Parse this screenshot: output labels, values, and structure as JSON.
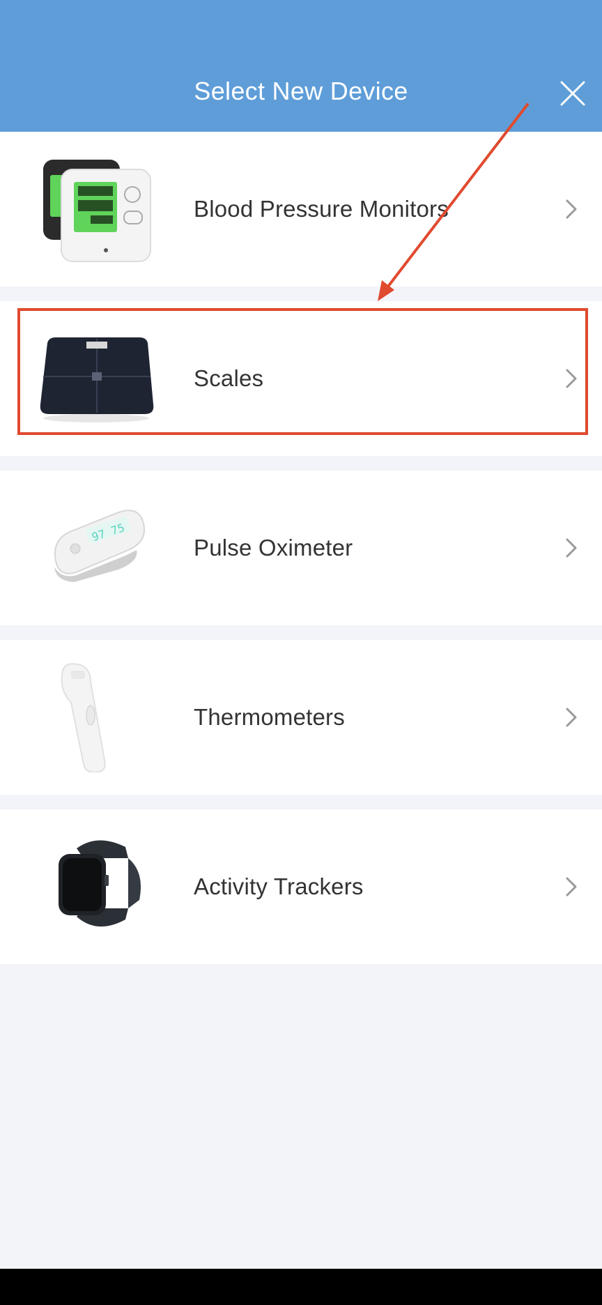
{
  "header": {
    "title": "Select New Device",
    "close_icon": "close-icon"
  },
  "devices": [
    {
      "label": "Blood Pressure Monitors",
      "icon": "blood-pressure-monitor-image"
    },
    {
      "label": "Scales",
      "icon": "scale-image"
    },
    {
      "label": "Pulse Oximeter",
      "icon": "pulse-oximeter-image"
    },
    {
      "label": "Thermometers",
      "icon": "thermometer-image"
    },
    {
      "label": "Activity Trackers",
      "icon": "activity-tracker-image"
    }
  ],
  "colors": {
    "header_bg": "#5e9dd8",
    "page_bg": "#f3f4f9",
    "annotation": "#e04a2f"
  }
}
